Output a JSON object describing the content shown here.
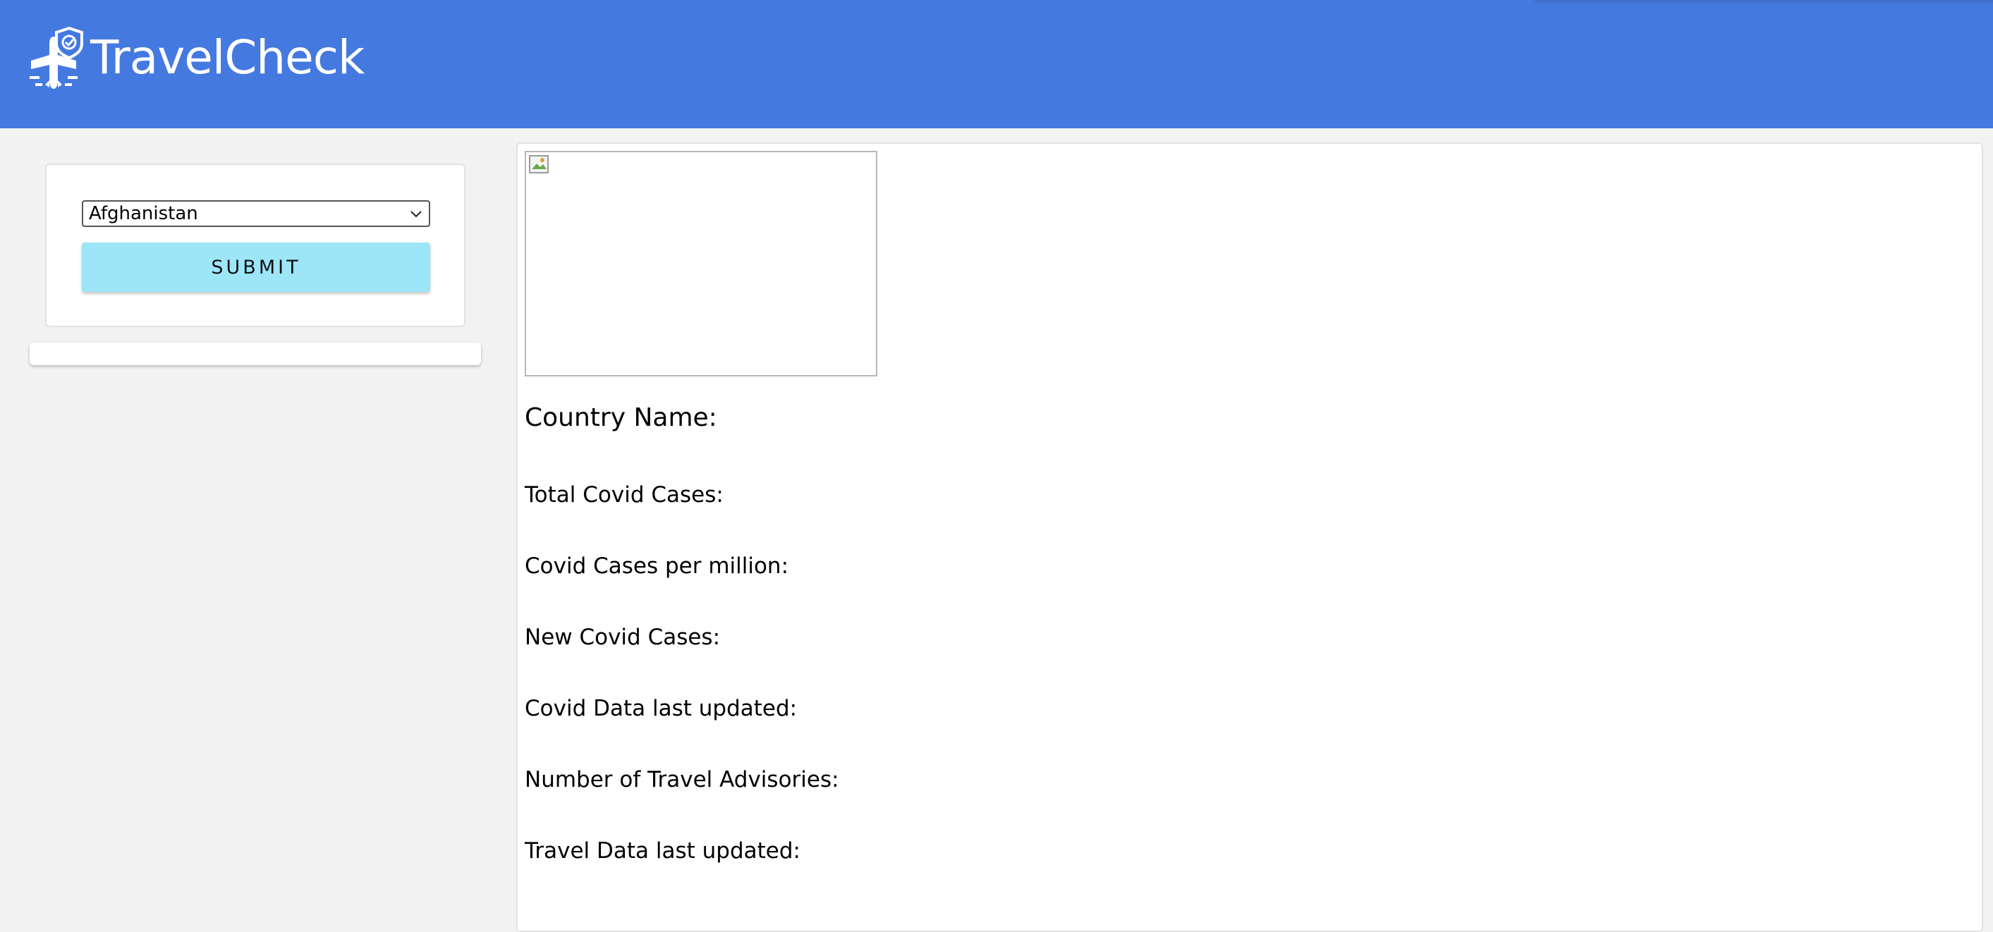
{
  "header": {
    "logo_text": "TravelCheck",
    "background_color": "#4479e0"
  },
  "sidebar": {
    "country_select": {
      "selected": "Afghanistan"
    },
    "submit_label": "SUBMIT",
    "submit_color": "#9ce6f8"
  },
  "main": {
    "country_name_label": "Country Name:",
    "fields": [
      "Total Covid Cases:",
      "Covid Cases per million:",
      "New Covid Cases:",
      "Covid Data last updated:",
      "Number of Travel Advisories:",
      "Travel Data last updated:"
    ]
  }
}
